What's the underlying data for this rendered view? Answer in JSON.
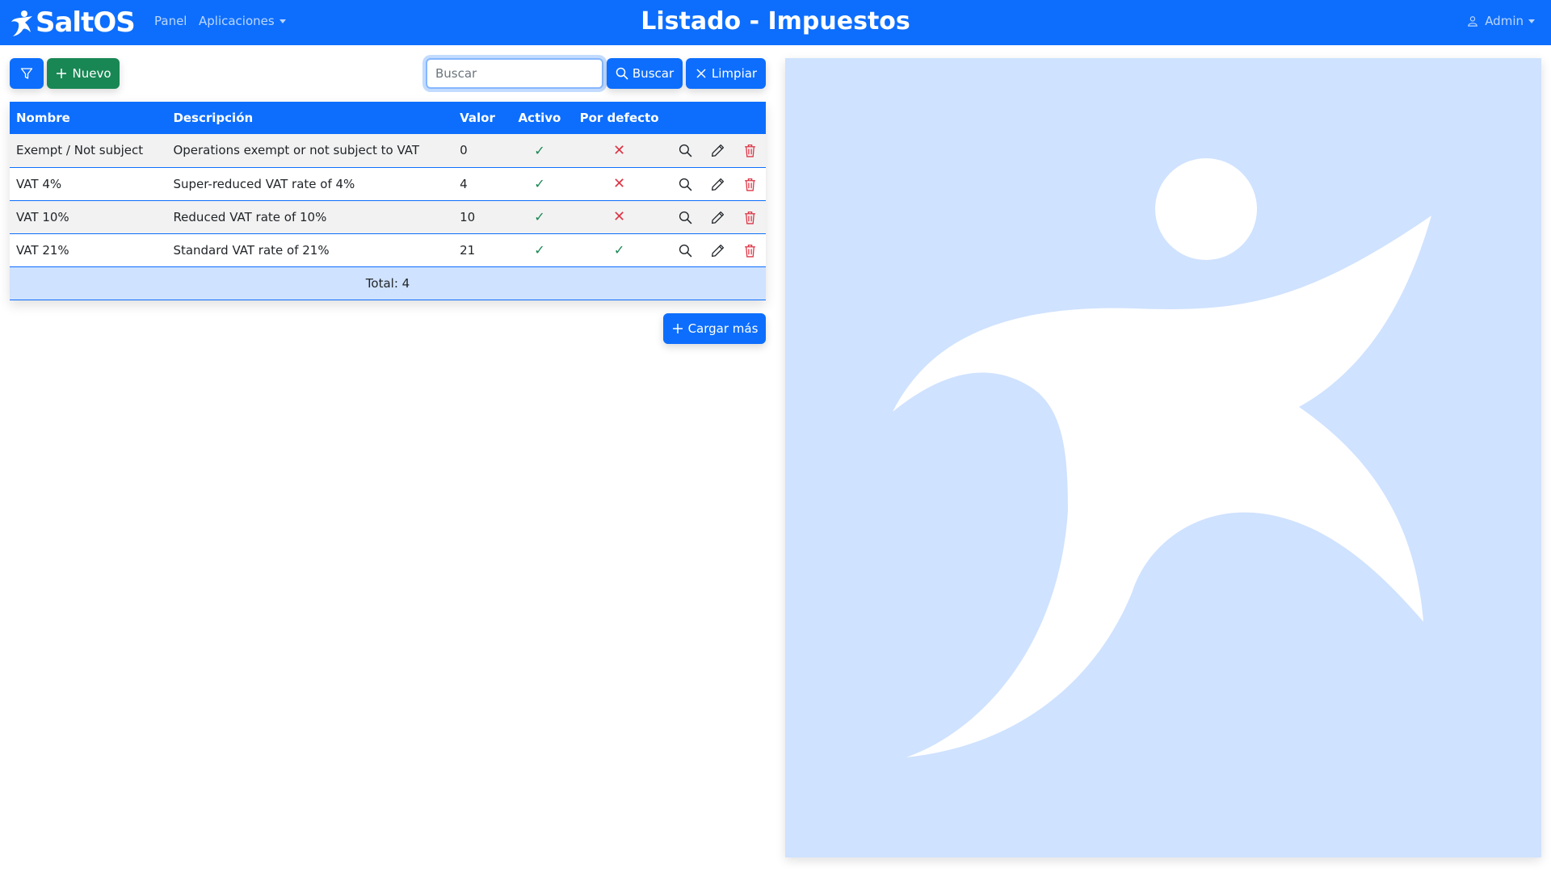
{
  "app": {
    "brand": "SaltOS",
    "title": "Listado - Impuestos",
    "nav": {
      "panel": "Panel",
      "apps": "Aplicaciones"
    },
    "user": "Admin"
  },
  "toolbar": {
    "new_label": "Nuevo",
    "search_placeholder": "Buscar",
    "search_label": "Buscar",
    "clear_label": "Limpiar"
  },
  "table": {
    "headers": [
      "Nombre",
      "Descripción",
      "Valor",
      "Activo",
      "Por defecto"
    ],
    "rows": [
      {
        "nombre": "Exempt / Not subject",
        "descripcion": "Operations exempt or not subject to VAT",
        "valor": "0",
        "activo": "✓",
        "por_defecto": "✕"
      },
      {
        "nombre": "VAT 4%",
        "descripcion": "Super-reduced VAT rate of 4%",
        "valor": "4",
        "activo": "✓",
        "por_defecto": "✕"
      },
      {
        "nombre": "VAT 10%",
        "descripcion": "Reduced VAT rate of 10%",
        "valor": "10",
        "activo": "✓",
        "por_defecto": "✕"
      },
      {
        "nombre": "VAT 21%",
        "descripcion": "Standard VAT rate of 21%",
        "valor": "21",
        "activo": "✓",
        "por_defecto": "✓"
      }
    ],
    "total": "Total: 4"
  },
  "load_more": "Cargar más",
  "colors": {
    "primary": "#0d6efd",
    "success": "#198754",
    "danger": "#dc3545",
    "panel_bg": "#cfe2ff"
  },
  "icons": {
    "filter": "funnel-icon",
    "new": "plus-icon",
    "search": "search-icon",
    "clear": "x-icon",
    "view": "search-icon",
    "edit": "pencil-icon",
    "delete": "trash-icon",
    "user": "person-icon"
  }
}
